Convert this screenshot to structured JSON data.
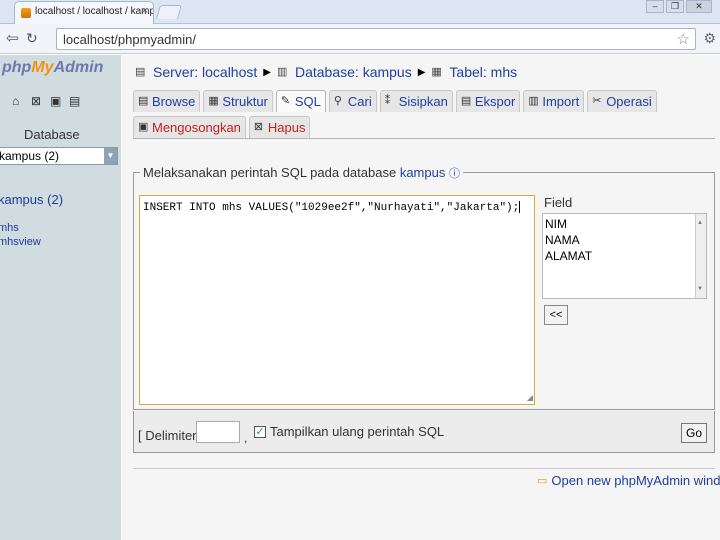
{
  "browser": {
    "tab_title": "localhost / localhost / kampus",
    "tab_close": "×",
    "address": "localhost/phpmyadmin/",
    "window_buttons": [
      "–",
      "❐",
      "✕"
    ]
  },
  "sidebar": {
    "logo": {
      "php": "php",
      "my": "My",
      "admin": "Admin"
    },
    "database_label": "Database",
    "database_selected": "kampus (2)",
    "current_db": "kampus (2)",
    "tables": [
      "mhs",
      "mhsview"
    ]
  },
  "breadcrumb": {
    "server": "Server: localhost",
    "database": "Database: kampus",
    "table": "Tabel: mhs"
  },
  "tabs": [
    {
      "label": "Browse",
      "icon": "browse-icon"
    },
    {
      "label": "Struktur",
      "icon": "structure-icon"
    },
    {
      "label": "SQL",
      "icon": "sql-icon",
      "active": true
    },
    {
      "label": "Cari",
      "icon": "search-icon"
    },
    {
      "label": "Sisipkan",
      "icon": "insert-icon"
    },
    {
      "label": "Ekspor",
      "icon": "export-icon"
    },
    {
      "label": "Import",
      "icon": "import-icon"
    },
    {
      "label": "Operasi",
      "icon": "operations-icon"
    }
  ],
  "tabs2": [
    {
      "label": "Mengosongkan",
      "icon": "empty-icon"
    },
    {
      "label": "Hapus",
      "icon": "drop-icon"
    }
  ],
  "sql_panel": {
    "legend_prefix": "Melaksanakan perintah SQL pada database",
    "legend_db": "kampus",
    "help": "ⓘ",
    "query": "INSERT INTO mhs VALUES(\"1029ee2f\",\"Nurhayati\",\"Jakarta\");",
    "field_label": "Field",
    "fields": [
      "NIM",
      "NAMA",
      "ALAMAT"
    ],
    "insert_button": "<<"
  },
  "options": {
    "delimiter_label": "[ Delimiter",
    "delimiter_value": "",
    "comma": ",",
    "show_again_checked": true,
    "show_again_label": "Tampilkan ulang perintah SQL",
    "go_button": "Go"
  },
  "footer": {
    "new_window_link": "Open new phpMyAdmin window"
  }
}
